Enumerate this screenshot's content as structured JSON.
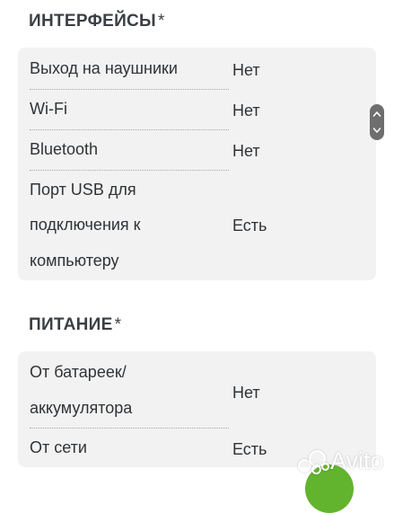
{
  "sections": [
    {
      "title": "ИНТЕРФЕЙСЫ",
      "asterisk": "*",
      "rows": [
        {
          "name": "Выход на наушники",
          "value": "Нет"
        },
        {
          "name": "Wi-Fi",
          "value": "Нет"
        },
        {
          "name": "Bluetooth",
          "value": "Нет"
        },
        {
          "name_lines": [
            "Порт USB для",
            "подключения к",
            "компьютеру"
          ],
          "value": "Есть"
        }
      ]
    },
    {
      "title": "ПИТАНИЕ",
      "asterisk": "*",
      "rows": [
        {
          "name_lines": [
            "От батареек/",
            "аккумулятора"
          ],
          "value": "Нет"
        },
        {
          "name": "От сети",
          "value": "Есть"
        }
      ]
    }
  ],
  "watermark": {
    "text": "Avito"
  },
  "colors": {
    "card_bg": "#f2f2f2",
    "text": "#2f3336",
    "fab": "#62b32e",
    "scroll_pill": "#6e6e6e"
  },
  "icons": {
    "scroll": "chevron-up-down-icon",
    "fab": "green-action-button"
  }
}
